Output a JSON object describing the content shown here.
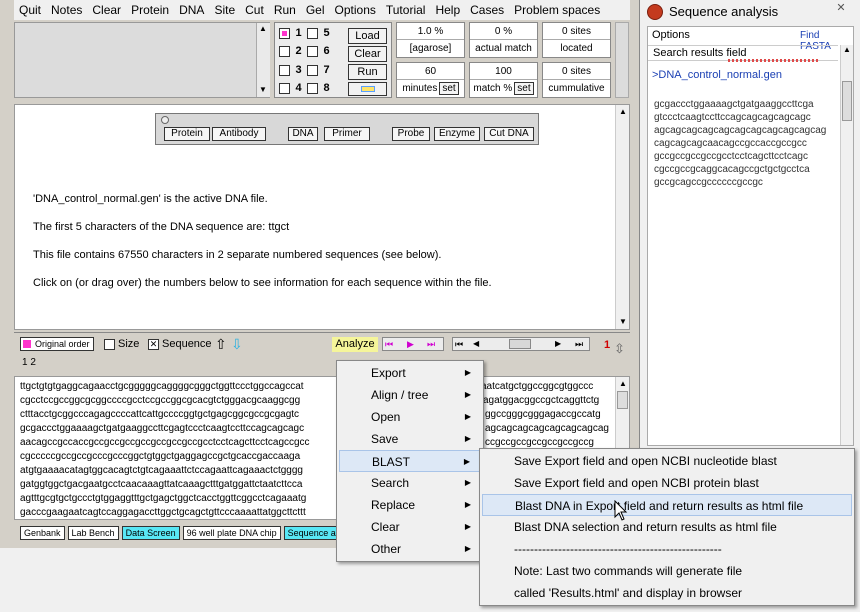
{
  "menu": [
    "Quit",
    "Notes",
    "Clear",
    "Protein",
    "DNA",
    "Site",
    "Cut",
    "Run",
    "Gel",
    "Options",
    "Tutorial",
    "Help",
    "Cases",
    "Problem spaces"
  ],
  "checks": {
    "rows": [
      [
        "1",
        "5"
      ],
      [
        "2",
        "6"
      ],
      [
        "3",
        "7"
      ],
      [
        "4",
        "8"
      ]
    ]
  },
  "buttons": {
    "load": "Load",
    "clear": "Clear",
    "run": "Run"
  },
  "stats": {
    "agarose_val": "1.0 %",
    "agarose_lbl": "[agarose]",
    "match_val": "0 %",
    "match_lbl": "actual match",
    "sites_val": "0  sites",
    "sites_lbl": "located",
    "minutes_val": "60",
    "minutes_lbl": "minutes",
    "set": "set",
    "matchpct_val": "100",
    "matchpct_lbl": "match %",
    "cum_val": "0  sites",
    "cum_lbl": "cummulative"
  },
  "tools": [
    "Protein",
    "Antibody",
    "DNA",
    "Primer",
    "Probe",
    "Enzyme",
    "Cut DNA"
  ],
  "doc": {
    "p1": "'DNA_control_normal.gen' is the active DNA file.",
    "p2": "The first 5 characters of the DNA sequence are:  ttgct",
    "p3": "This file contains 67550 characters in 2 separate numbered sequences (see below).",
    "p4": "Click on (or drag over) the numbers below to see information for each sequence within the file."
  },
  "ctl": {
    "original": "Original order",
    "size": "Size",
    "sequence": "Sequence",
    "analyze": "Analyze",
    "nums": "1  2",
    "count": "1"
  },
  "seq": [
    "ttgctgtgtgaggcagaacctgcgggggcaggggcgggctggttccctggccagccat",
    "cgcctccgccggcgcggccccgcctccgccggcgcacgtctgggacgcaaggcgg",
    "ctttacctgcggcccagagccccattcattgccccggtgctgagcggcgccgcgagtc",
    "gcgaccctggaaaagctgatgaaggccttcgagtccctcaagtccttccagcagcagc",
    "aacagccgccaccgccgccgccgccgccgccgccgcctcctcagcttcctcagccgcc",
    "cgcccccgccgccgcccgcccggctgtggctgaggagccgctgcaccgaccaaga",
    "atgtgaaaacatagtggcacagtctgtcagaaattctccagaattcagaaactctgggg",
    "gatggtggctgacgaatgcctcaacaaagttatcaaagctttgatggattctaatcttcca",
    "agtttgcgtgctgccctgtggaggtttgctgagctggctcacctggttcggcctcagaaatg",
    "gacccgaagaatcagtccaggagaccttggctgcagctgttcccaaaattatggcttcttt"
  ],
  "seq_right": [
    "aatcatgctggccggcgtggccc",
    "agatggacggccgctcaggttctg",
    "ggccgggcgggagaccgccatg",
    "agcagcagcagcagcagcagcag",
    "ccgccgccgccgccgccgccg"
  ],
  "tabs": [
    "Genbank",
    "Lab Bench",
    "Data Screen",
    "96 well plate   DNA chip",
    "Sequence a"
  ],
  "right": {
    "title": "Sequence analysis",
    "close": "✕",
    "options": "Options",
    "find": "Find FASTA",
    "search": "Search results field",
    "filename": ">DNA_control_normal.gen",
    "seq": [
      "gcgaccctggaaaagctgatgaaggccttcga",
      "gtccctcaagtccttccagcagcagcagcagc",
      "agcagcagcagcagcagcagcagcagcagcag",
      "cagcagcagcaacagccgccaccgccgcc",
      "gccgccgccgccgcctcctcagcttcctcagc",
      "cgccgccgcaggcacagccgctgctgcctca",
      "gccgcagccgccccccgccgc"
    ]
  },
  "context": {
    "items": [
      "Export",
      "Align / tree",
      "Open",
      "Save",
      "BLAST",
      "Search",
      "Replace",
      "Clear",
      "Other"
    ]
  },
  "blast": {
    "items": [
      "Save Export field and open NCBI nucleotide blast",
      "Save  Export field and open NCBI protein blast",
      "Blast DNA in Export field and return results as html file",
      "Blast DNA selection and return results as html file",
      "----------------------------------------------------",
      "Note:  Last two commands will generate file",
      "called 'Results.html' and display in browser"
    ]
  }
}
